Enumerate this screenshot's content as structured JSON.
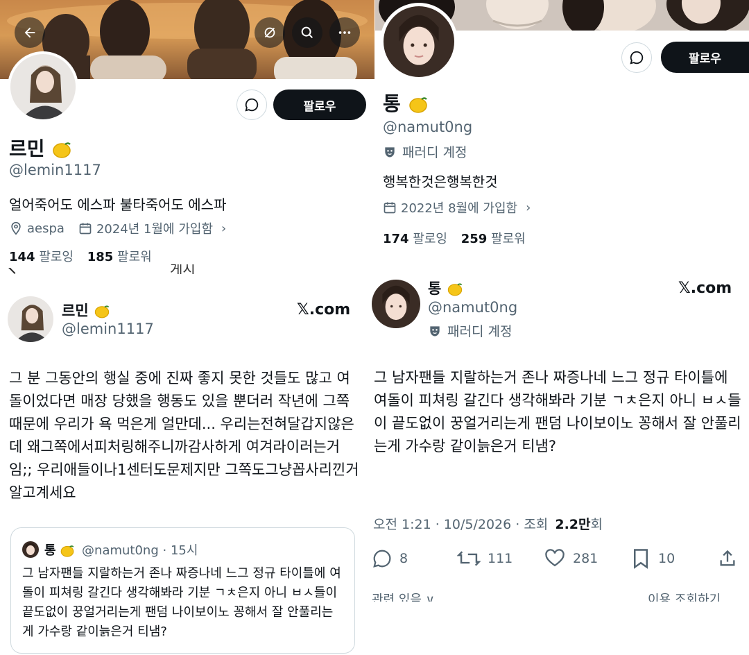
{
  "left_profile": {
    "display_name": "르민",
    "handle": "@lemin1117",
    "bio": "얼어죽어도 에스파 불타죽어도 에스파",
    "location": "aespa",
    "joined": "2024년 1월에 가입함",
    "following_count": "144",
    "following_label": "팔로잉",
    "followers_count": "185",
    "followers_label": "팔로워",
    "follow_button": "팔로우",
    "truncated_text": "게시"
  },
  "left_tweet": {
    "display_name": "르민",
    "handle": "@lemin1117",
    "brand": "𝕏.com",
    "text": "그 분 그동안의 행실 중에 진짜 좋지 못한 것들도 많고 여돌이었다면 매장 당했을 행동도 있을 뿐더러 작년에 그쪽 때문에 우리가 욕 먹은게 얼만데... 우리는전혀달갑지않은데 왜그쪽에서피처링해주니까감사하게 여겨라이러는거임;; 우리애들이나1센터도문제지만 그쪽도그냥꼽사리낀거알고계세요"
  },
  "quote_tweet": {
    "display_name": "통",
    "handle": "@namut0ng",
    "time": "· 15시",
    "text": "그 남자팬들 지랄하는거 존나 짜증나네 느그 정규 타이틀에 여돌이 피쳐링 갈긴다 생각해봐라 기분 ㄱㅊ은지 아니 ㅂㅅ들이 끝도없이 꿍얼거리는게 팬덤 나이보이노 꽁해서 잘 안풀리는게 가수랑 같이늙은거 티냄?"
  },
  "right_profile": {
    "display_name": "통",
    "handle": "@namut0ng",
    "parody_label": "패러디 계정",
    "bio": "행복한것은행복한것",
    "joined": "2022년 8월에 가입함",
    "following_count": "174",
    "following_label": "팔로잉",
    "followers_count": "259",
    "followers_label": "팔로워",
    "follow_button": "팔로우"
  },
  "right_tweet": {
    "display_name": "통",
    "handle": "@namut0ng",
    "parody_label": "패러디 계정",
    "brand": "𝕏.com",
    "text": "그 남자팬들 지랄하는거 존나 짜증나네 느그 정규 타이틀에 여돌이 피쳐링 갈긴다 생각해봐라 기분 ㄱㅊ은지 아니 ㅂㅅ들이 끝도없이 꿍얼거리는게 팬덤 나이보이노 꽁해서 잘 안풀리는게 가수랑 같이늙은거 티냄?",
    "timestamp": "오전 1:21 · 10/5/2026 · 조회",
    "views": "2.2만",
    "views_suffix": "회",
    "replies": "8",
    "retweets": "111",
    "likes": "281",
    "bookmarks": "10",
    "cut_left": "관련 있음 ∨",
    "cut_right": "이용 조회하기"
  },
  "icons": {
    "back": "arrow-left-icon",
    "hide": "eye-slash-icon",
    "search": "search-icon",
    "more": "more-icon",
    "message": "message-icon",
    "location": "location-pin-icon",
    "calendar": "calendar-icon",
    "parody": "theater-mask-icon",
    "reply": "reply-icon",
    "retweet": "retweet-icon",
    "like": "heart-icon",
    "bookmark": "bookmark-icon",
    "share": "share-icon",
    "lemon": "lemon-emoji"
  },
  "colors": {
    "text": "#0f1419",
    "muted": "#536471",
    "button_dark": "#0f1419",
    "border": "#cfd9de"
  }
}
